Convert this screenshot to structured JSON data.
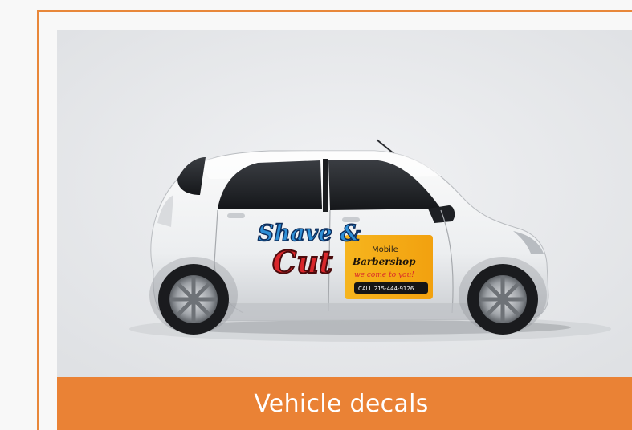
{
  "colors": {
    "accent": "#ea8235",
    "border": "#e8873a",
    "page_background": "#f8f8f8",
    "photo_background": "#e4e6e9"
  },
  "gallery_item": {
    "caption": "Vehicle decals",
    "photo": {
      "subject": "car-photo",
      "decal": {
        "brand_line1": "Shave &",
        "brand_line2": "Cut",
        "tagline_mobile": "Mobile",
        "tagline_business": "Barbershop",
        "slogan": "we come to you!",
        "phone": "CALL 215-444-9126"
      }
    }
  }
}
